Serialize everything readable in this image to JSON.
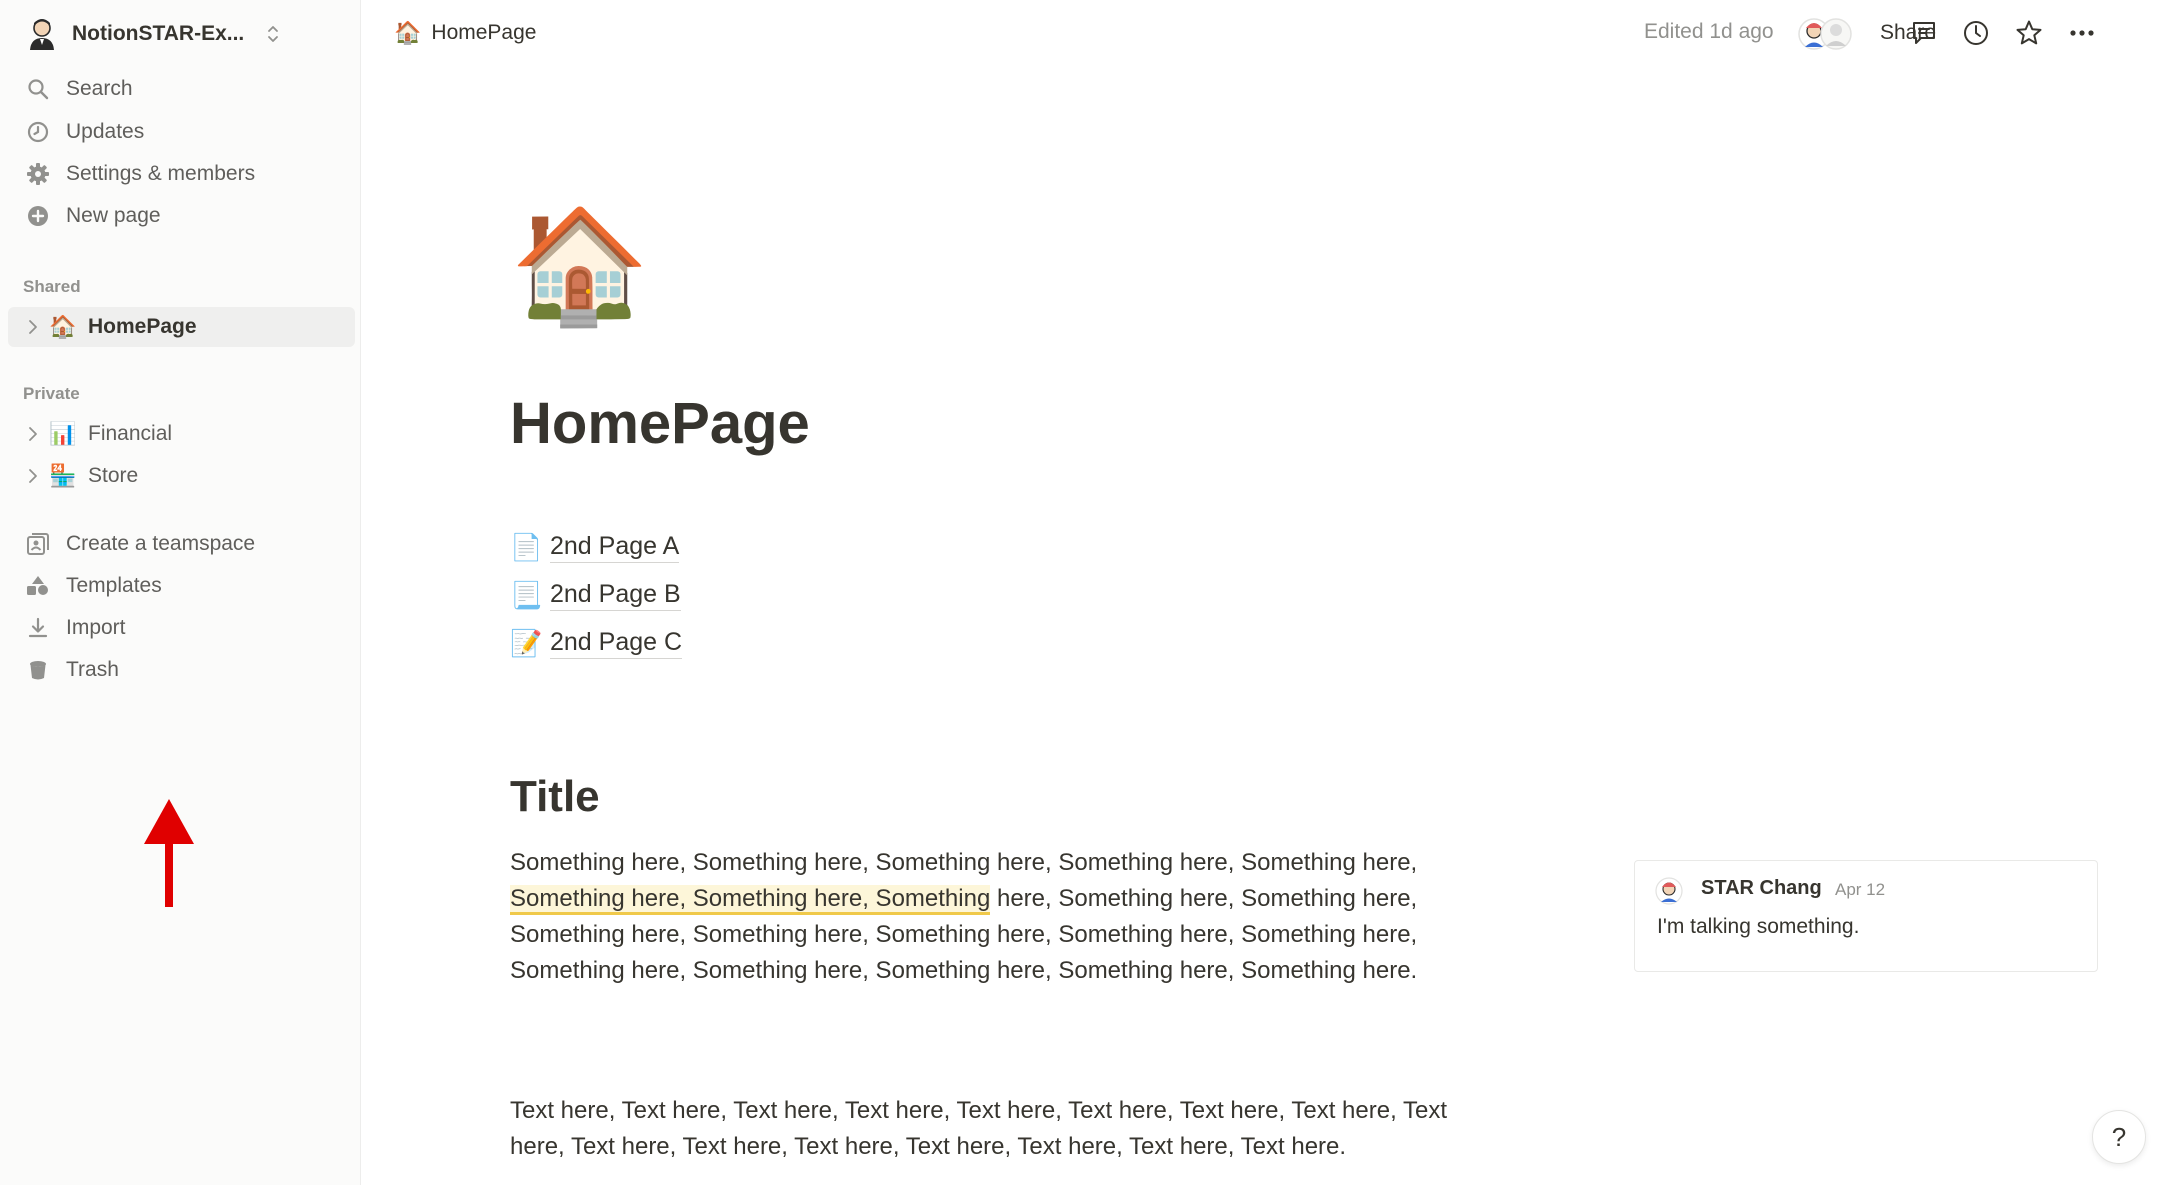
{
  "workspace": {
    "name": "NotionSTAR-Ex..."
  },
  "sidebar": {
    "quick": [
      {
        "label": "Search",
        "icon": "search-icon"
      },
      {
        "label": "Updates",
        "icon": "clock-icon"
      },
      {
        "label": "Settings & members",
        "icon": "gear-icon"
      },
      {
        "label": "New page",
        "icon": "plus-circle-icon"
      }
    ],
    "shared_label": "Shared",
    "shared_pages": [
      {
        "emoji": "🏠",
        "label": "HomePage"
      }
    ],
    "private_label": "Private",
    "private_pages": [
      {
        "emoji": "📊",
        "label": "Financial"
      },
      {
        "emoji": "🏪",
        "label": "Store"
      }
    ],
    "bottom": [
      {
        "label": "Create a teamspace",
        "icon": "teamspace-icon"
      },
      {
        "label": "Templates",
        "icon": "templates-icon"
      },
      {
        "label": "Import",
        "icon": "download-icon"
      },
      {
        "label": "Trash",
        "icon": "trash-icon"
      }
    ]
  },
  "topbar": {
    "breadcrumb_emoji": "🏠",
    "breadcrumb": "HomePage",
    "edited": "Edited 1d ago",
    "share": "Share"
  },
  "page": {
    "icon": "🏠",
    "title": "HomePage",
    "subpages": [
      {
        "emoji": "📄",
        "label": "2nd Page A"
      },
      {
        "emoji": "📃",
        "label": "2nd Page B"
      },
      {
        "emoji": "📝",
        "label": "2nd Page C"
      }
    ],
    "heading": "Title",
    "para1_before": "Something here, Something here, Something here, Something here, Something here, ",
    "para1_highlight": "Something here, Something here, Something",
    "para1_after": " here, Something here, Something here, Something here, Something here, Something here, Something here, Something here, Something here, Something here, Something here, Something here, Something here.",
    "para2": "Text here, Text here, Text here, Text here, Text here, Text here, Text here, Text here, Text here, Text here, Text here, Text here, Text here, Text here, Text here, Text here."
  },
  "comment": {
    "author": "STAR Chang",
    "date": "Apr 12",
    "text": "I'm talking something."
  },
  "help": "?",
  "colors": {
    "accent_highlight": "#f0c94a",
    "arrow": "#e00000"
  }
}
